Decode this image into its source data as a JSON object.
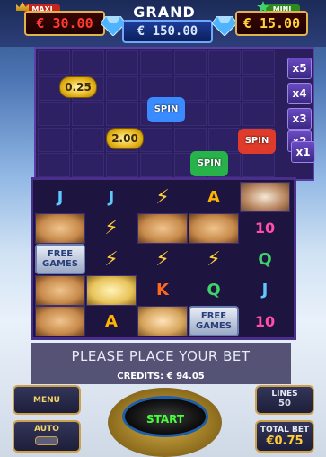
{
  "jackpots": {
    "maxi": {
      "label": "MAXI",
      "value": "€ 30.00"
    },
    "grand": {
      "label": "GRAND",
      "value": "€ 150.00"
    },
    "mini": {
      "label": "MINI",
      "value": "€ 15.00"
    }
  },
  "bonus_grid": {
    "multipliers": [
      "x5",
      "x4",
      "x3",
      "x2",
      "x1"
    ],
    "items": [
      {
        "type": "coin",
        "label": "0.25"
      },
      {
        "type": "coin",
        "label": "2.00"
      },
      {
        "type": "spin-diamond",
        "label": "SPIN"
      },
      {
        "type": "spin-crown",
        "label": "SPIN"
      },
      {
        "type": "spin-star",
        "label": "SPIN"
      }
    ]
  },
  "reels": [
    [
      "J",
      "hero",
      "FREE GAMES",
      "hero",
      "hero"
    ],
    [
      "J",
      "bolt",
      "bolt",
      "hermes",
      "A"
    ],
    [
      "bolt",
      "hero",
      "bolt",
      "K",
      "woman"
    ],
    [
      "A",
      "hero",
      "bolt",
      "Q",
      "FREE GAMES"
    ],
    [
      "zeus",
      "10",
      "Q",
      "J",
      "10"
    ]
  ],
  "message": "PLEASE PLACE YOUR BET",
  "credits": "CREDITS: € 94.05",
  "controls": {
    "menu_label": "MENU",
    "auto_label": "AUTO",
    "start_label": "START",
    "lines_label": "LINES",
    "lines_value": "50",
    "total_bet_label": "TOTAL BET",
    "total_bet_value": "€0.75"
  },
  "colors": {
    "accent_gold": "#cda04b",
    "start_green": "#46ff3a",
    "jackpot_red": "#ff3b2f"
  }
}
